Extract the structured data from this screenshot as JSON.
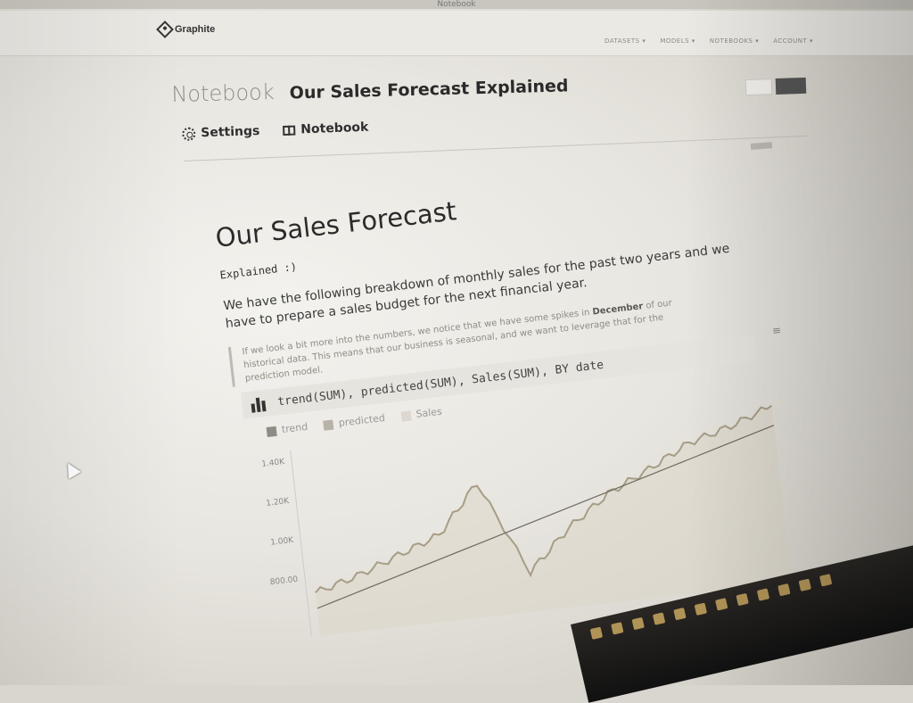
{
  "os": {
    "title": "Notebook"
  },
  "app": {
    "brand": "Graphite"
  },
  "nav": {
    "links": [
      "DATASETS ▾",
      "MODELS ▾",
      "NOTEBOOKS ▾",
      "ACCOUNT ▾"
    ]
  },
  "header": {
    "crumb": "Notebook",
    "title": "Our Sales Forecast Explained"
  },
  "tabs": [
    {
      "label": "Settings",
      "icon": "gear-icon"
    },
    {
      "label": "Notebook",
      "icon": "book-icon"
    }
  ],
  "doc": {
    "title": "Our Sales Forecast",
    "subtitle": "Explained :)",
    "lead": "We have the following breakdown of monthly sales for the past two years and we have to prepare a sales budget for the next financial year.",
    "quote_pre": "If we look a bit more into the numbers, we notice that we have some spikes in ",
    "quote_bold": "December",
    "quote_post": " of our historical data. This means that our business is seasonal, and we want to leverage that for the prediction model."
  },
  "query": {
    "text": "trend(SUM), predicted(SUM), Sales(SUM), BY date",
    "icon": "bar-chart-icon"
  },
  "legend": [
    {
      "label": "trend",
      "color": "#8f8c86"
    },
    {
      "label": "predicted",
      "color": "#b7b2a6"
    },
    {
      "label": "Sales",
      "color": "#dcd8cf"
    }
  ],
  "chart_data": {
    "type": "line",
    "y_ticks": [
      "1.40K",
      "1.20K",
      "1.00K",
      "800.00"
    ],
    "ylim": [
      800,
      1400
    ],
    "series": [
      {
        "name": "trend",
        "values": [
          640,
          700,
          760,
          820,
          880,
          940,
          1000,
          1060,
          1120,
          1180,
          1240,
          1300
        ]
      },
      {
        "name": "Sales",
        "values": [
          720,
          780,
          860,
          940,
          1180,
          700,
          900,
          1050,
          1150,
          1260,
          1320,
          1400
        ]
      }
    ]
  },
  "colors": {
    "accent": "#2b2b2b",
    "line": "#a79d86",
    "fill": "#dcd6c7"
  }
}
